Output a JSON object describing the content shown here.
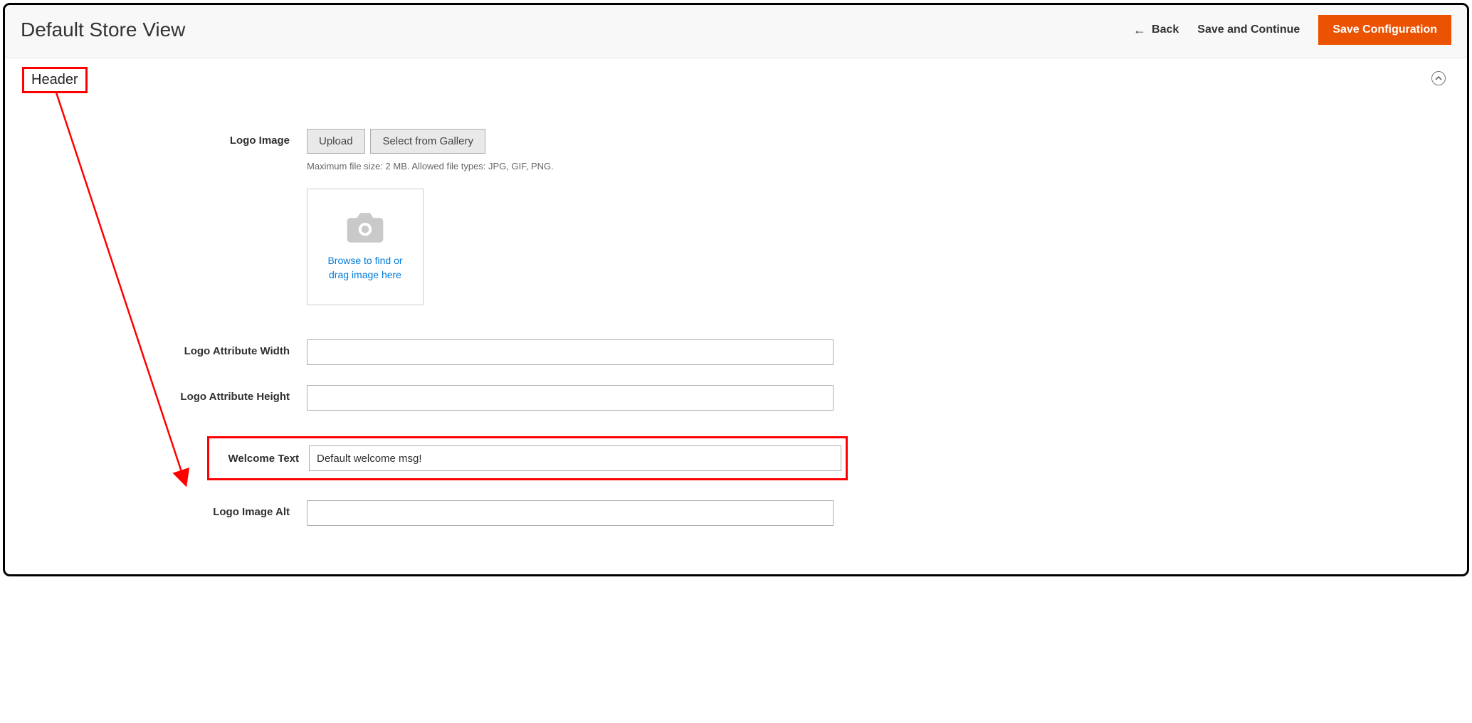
{
  "header": {
    "title": "Default Store View",
    "back": "Back",
    "save_continue": "Save and Continue",
    "save_config": "Save Configuration"
  },
  "section": {
    "title": "Header"
  },
  "form": {
    "logo_image": {
      "label": "Logo Image",
      "upload_btn": "Upload",
      "gallery_btn": "Select from Gallery",
      "helper": "Maximum file size: 2 MB. Allowed file types: JPG, GIF, PNG.",
      "dropzone_line1": "Browse to find or",
      "dropzone_line2": "drag image here"
    },
    "logo_width": {
      "label": "Logo Attribute Width",
      "value": ""
    },
    "logo_height": {
      "label": "Logo Attribute Height",
      "value": ""
    },
    "welcome_text": {
      "label": "Welcome Text",
      "value": "Default welcome msg!"
    },
    "logo_alt": {
      "label": "Logo Image Alt",
      "value": ""
    }
  }
}
